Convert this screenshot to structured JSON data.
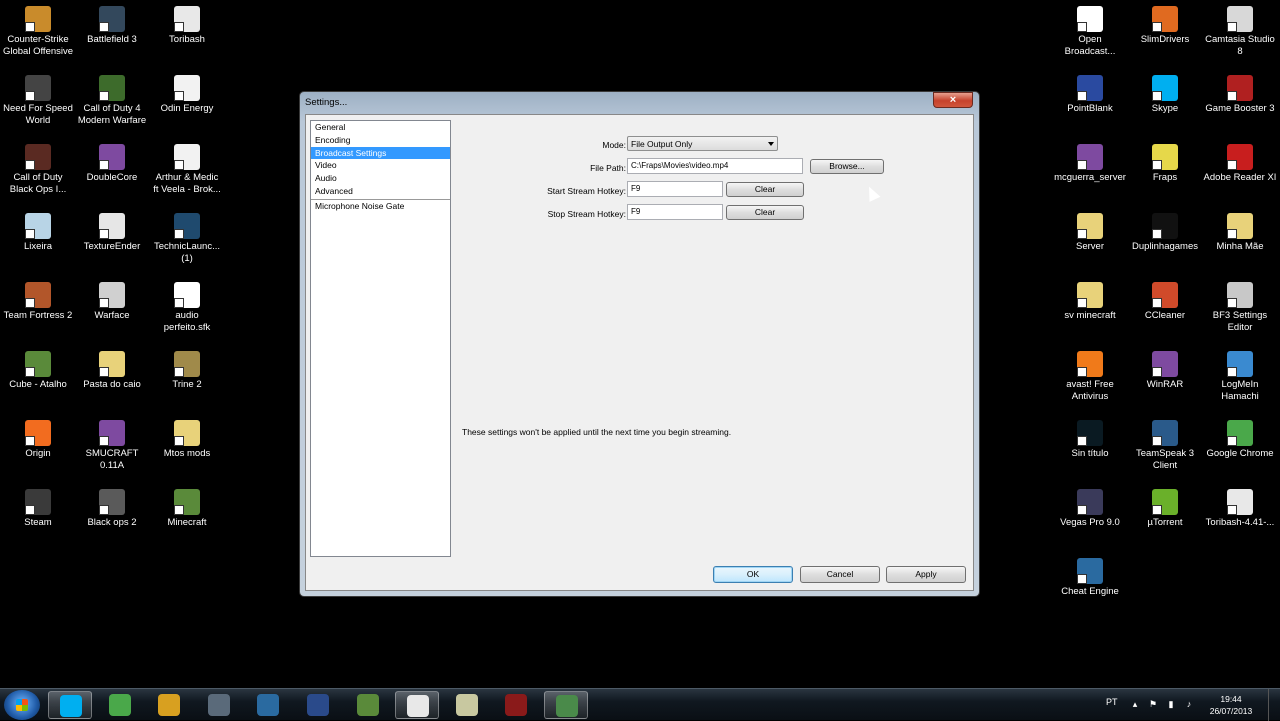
{
  "desktop": {
    "left_icons": [
      {
        "label": "Counter-Strike\nGlobal Offensive",
        "color": "#c98b2b",
        "icon": "csgo-icon"
      },
      {
        "label": "Battlefield 3",
        "color": "#33485c",
        "icon": "battlefield3-icon"
      },
      {
        "label": "Toribash",
        "color": "#e8e8e8",
        "icon": "toribash-icon"
      },
      {
        "label": "Need For Speed\nWorld",
        "color": "#444444",
        "icon": "nfs-world-icon"
      },
      {
        "label": "Call of Duty 4\nModern Warfare",
        "color": "#3d6b2b",
        "icon": "cod4-icon"
      },
      {
        "label": "Odin  Energy",
        "color": "#f2f2f2",
        "icon": "mp3-file-icon"
      },
      {
        "label": "Call of Duty\nBlack Ops I...",
        "color": "#5a2a22",
        "icon": "cod-blackops-icon"
      },
      {
        "label": "DoubleCore",
        "color": "#7e4aa0",
        "icon": "winrar-archive-icon"
      },
      {
        "label": "Arthur & Medic\nft Veela - Brok...",
        "color": "#f2f2f2",
        "icon": "mp3-file-icon"
      },
      {
        "label": "Lixeira",
        "color": "#b8d4e6",
        "icon": "recycle-bin-icon"
      },
      {
        "label": "TextureEnder",
        "color": "#e6e6e6",
        "icon": "file-icon"
      },
      {
        "label": "TechnicLaunc...\n(1)",
        "color": "#1f4a6e",
        "icon": "technic-launcher-icon"
      },
      {
        "label": "Team Fortress 2",
        "color": "#b2562a",
        "icon": "tf2-icon"
      },
      {
        "label": "Warface",
        "color": "#d0d0d0",
        "icon": "warface-icon"
      },
      {
        "label": "audio\nperfeito.sfk",
        "color": "#ffffff",
        "icon": "file-icon"
      },
      {
        "label": "Cube - Atalho",
        "color": "#5a8a3a",
        "icon": "minecraft-cube-icon"
      },
      {
        "label": "Pasta do caio",
        "color": "#e8d27a",
        "icon": "folder-icon"
      },
      {
        "label": "Trine 2",
        "color": "#a08a4a",
        "icon": "trine2-icon"
      },
      {
        "label": "Origin",
        "color": "#f26c1f",
        "icon": "origin-icon"
      },
      {
        "label": "SMUCRAFT\n0.11A",
        "color": "#7e4aa0",
        "icon": "winrar-archive-icon"
      },
      {
        "label": "Mtos mods",
        "color": "#e8d27a",
        "icon": "folder-icon"
      },
      {
        "label": "Steam",
        "color": "#3a3a3a",
        "icon": "steam-icon"
      },
      {
        "label": "Black ops 2",
        "color": "#5a5a5a",
        "icon": "blackops2-icon"
      },
      {
        "label": "Minecraft",
        "color": "#5a8a3a",
        "icon": "minecraft-icon"
      }
    ],
    "right_icons": [
      {
        "label": "Open\nBroadcast...",
        "color": "#ffffff",
        "icon": "obs-icon"
      },
      {
        "label": "SlimDrivers",
        "color": "#e06a20",
        "icon": "slimdrivers-icon"
      },
      {
        "label": "Camtasia Studio\n8",
        "color": "#d8d8d8",
        "icon": "camtasia-icon"
      },
      {
        "label": "PointBlank",
        "color": "#2a4aa0",
        "icon": "pointblank-icon"
      },
      {
        "label": "Skype",
        "color": "#00aff0",
        "icon": "skype-icon"
      },
      {
        "label": "Game Booster 3",
        "color": "#b02020",
        "icon": "game-booster-icon"
      },
      {
        "label": "mcguerra_server",
        "color": "#7e4aa0",
        "icon": "winrar-archive-icon"
      },
      {
        "label": "Fraps",
        "color": "#e6d84a",
        "icon": "fraps-icon"
      },
      {
        "label": "Adobe Reader XI",
        "color": "#c81e1e",
        "icon": "adobe-reader-icon"
      },
      {
        "label": "Server",
        "color": "#e8d27a",
        "icon": "folder-icon"
      },
      {
        "label": "Duplinhagames",
        "color": "#111111",
        "icon": "blank-icon"
      },
      {
        "label": "Minha Mãe",
        "color": "#e8d27a",
        "icon": "folder-icon"
      },
      {
        "label": "sv minecraft",
        "color": "#e8d27a",
        "icon": "folder-icon"
      },
      {
        "label": "CCleaner",
        "color": "#d04a2a",
        "icon": "ccleaner-icon"
      },
      {
        "label": "BF3 Settings\nEditor",
        "color": "#c8c8c8",
        "icon": "bf3-settings-icon"
      },
      {
        "label": "avast! Free\nAntivirus",
        "color": "#f07a1a",
        "icon": "avast-icon"
      },
      {
        "label": "WinRAR",
        "color": "#7e4aa0",
        "icon": "winrar-icon"
      },
      {
        "label": "LogMeIn\nHamachi",
        "color": "#3a8ad0",
        "icon": "hamachi-icon"
      },
      {
        "label": "Sin título",
        "color": "#0a1a22",
        "icon": "image-icon"
      },
      {
        "label": "TeamSpeak 3\nClient",
        "color": "#2a5a8a",
        "icon": "teamspeak-icon"
      },
      {
        "label": "Google Chrome",
        "color": "#4aa84a",
        "icon": "chrome-icon"
      },
      {
        "label": "Vegas Pro 9.0",
        "color": "#3a3a5a",
        "icon": "vegas-pro-icon"
      },
      {
        "label": "µTorrent",
        "color": "#6ab02a",
        "icon": "utorrent-icon"
      },
      {
        "label": "Toribash-4.41-...",
        "color": "#e8e8e8",
        "icon": "toribash-icon"
      },
      {
        "label": "Cheat Engine",
        "color": "#2a6aa0",
        "icon": "cheat-engine-icon"
      }
    ]
  },
  "dialog": {
    "title": "Settings...",
    "close_label": "×",
    "categories": [
      {
        "label": "General",
        "selected": false
      },
      {
        "label": "Encoding",
        "selected": false
      },
      {
        "label": "Broadcast Settings",
        "selected": true
      },
      {
        "label": "Video",
        "selected": false
      },
      {
        "label": "Audio",
        "selected": false
      },
      {
        "label": "Advanced",
        "selected": false
      }
    ],
    "extra_category": "Microphone Noise Gate",
    "mode_label": "Mode:",
    "mode_value": "File Output Only",
    "file_path_label": "File Path:",
    "file_path_value": "C:\\Fraps\\Movies\\video.mp4",
    "browse_label": "Browse...",
    "start_hotkey_label": "Start Stream Hotkey:",
    "start_hotkey_value": "F9",
    "stop_hotkey_label": "Stop Stream Hotkey:",
    "stop_hotkey_value": "F9",
    "clear_label": "Clear",
    "note": "These settings won't be applied until the next time you begin streaming.",
    "ok_label": "OK",
    "cancel_label": "Cancel",
    "apply_label": "Apply"
  },
  "taskbar": {
    "start_icon": "windows-start-icon",
    "items": [
      {
        "icon": "skype-icon",
        "color": "#00aff0",
        "active": true
      },
      {
        "icon": "chrome-icon",
        "color": "#4aa84a",
        "active": false
      },
      {
        "icon": "winrar-icon",
        "color": "#d8a020",
        "active": false
      },
      {
        "icon": "gamepad-icon",
        "color": "#5a6a7a",
        "active": false
      },
      {
        "icon": "cheat-engine-icon",
        "color": "#2a6aa0",
        "active": false
      },
      {
        "icon": "monitor-icon",
        "color": "#2a4a8a",
        "active": false
      },
      {
        "icon": "minecraft-icon",
        "color": "#5a8a3a",
        "active": false
      },
      {
        "icon": "obs-icon",
        "color": "#e8e8e8",
        "active": true
      },
      {
        "icon": "fraps-icon",
        "color": "#c8c8a0",
        "active": false
      },
      {
        "icon": "blackops2-icon",
        "color": "#8a1a1a",
        "active": false
      },
      {
        "icon": "camtasia-icon",
        "color": "#4a8a4a",
        "active": true
      }
    ],
    "language": "PT",
    "clock_time": "19:44",
    "clock_date": "26/07/2013"
  }
}
